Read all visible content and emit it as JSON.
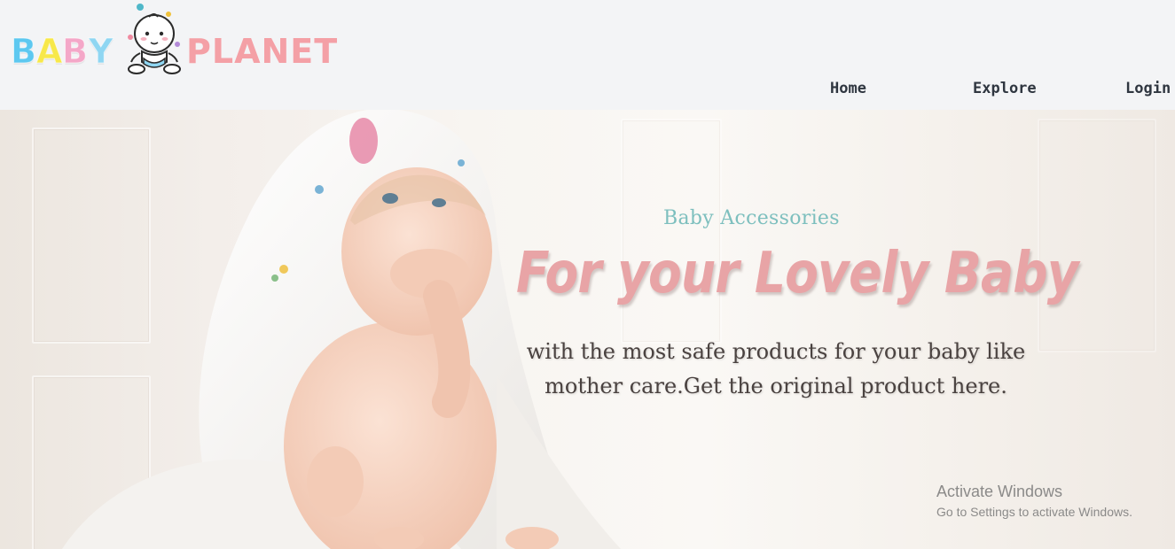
{
  "brand": {
    "logo_letters": [
      {
        "char": "B",
        "color": "#5dc8f0"
      },
      {
        "char": "A",
        "color": "#f7e84a"
      },
      {
        "char": "B",
        "color": "#f4a7c8"
      },
      {
        "char": "Y",
        "color": "#8fd6f2"
      }
    ],
    "logo_word2": "PLANET",
    "logo_word2_color": "#f4a0a6",
    "mascot_icon": "baby-mascot-icon"
  },
  "nav": {
    "home_label": "Home",
    "explore_label": "Explore",
    "login_label": "Login"
  },
  "hero": {
    "eyebrow": "Baby Accessories",
    "title": "For your Lovely Baby",
    "description_line1": "with the most safe products for your baby like",
    "description_line2": "mother care.Get the original product here.",
    "eyebrow_color": "#7dbfbe",
    "title_color": "#e8a4a6",
    "photo": "baby-in-hooded-towel"
  },
  "watermark": {
    "title": "Activate Windows",
    "subtitle": "Go to Settings to activate Windows."
  }
}
